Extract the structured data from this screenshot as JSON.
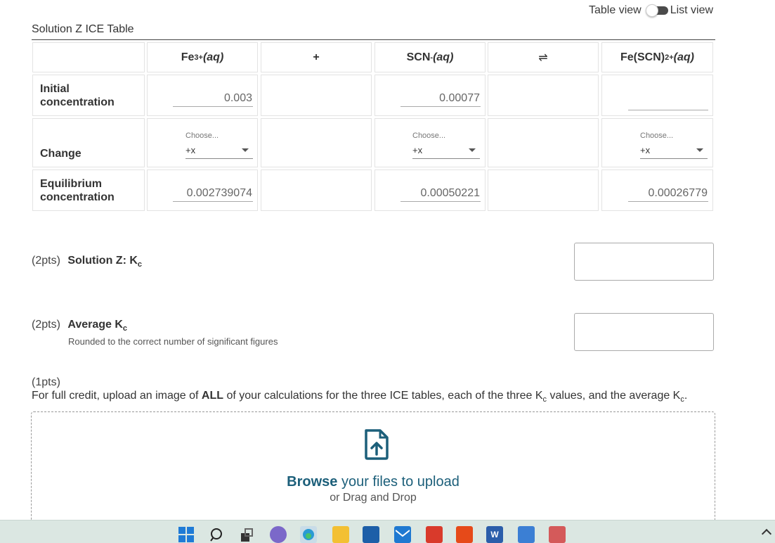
{
  "view_toggle": {
    "left_label": "Table view",
    "right_label": "List view"
  },
  "table": {
    "title": "Solution Z ICE Table",
    "headers": {
      "fe_base": "Fe",
      "fe_sup": "3+",
      "fe_aq": "(aq)",
      "plus": "+",
      "scn_base": "SCN",
      "scn_sup": "-",
      "scn_aq": "(aq)",
      "equilibrium": "⇌",
      "fescn_base": "Fe(SCN)",
      "fescn_sup": "2+",
      "fescn_aq": "(aq)"
    },
    "rows": {
      "initial_label": "Initial concentration",
      "change_label": "Change",
      "equilibrium_label": "Equilibrium concentration"
    },
    "initial": {
      "fe": "0.003",
      "scn": "0.00077",
      "fescn": ""
    },
    "change": {
      "placeholder": "Choose...",
      "fe": "+x",
      "scn": "+x",
      "fescn": "+x"
    },
    "equilibrium": {
      "fe": "0.002739074",
      "scn": "0.00050221",
      "fescn": "0.00026779"
    }
  },
  "questions": {
    "q1": {
      "points": "(2pts)",
      "title": "Solution Z: K",
      "title_sub": "c",
      "answer": ""
    },
    "q2": {
      "points": "(2pts)",
      "title": "Average K",
      "title_sub": "c",
      "subtitle": "Rounded to the correct number of significant figures",
      "answer": ""
    },
    "q3": {
      "points": "(1pts)",
      "text_a": "For full credit, upload an image of ",
      "text_bold": "ALL",
      "text_b": " of your calculations for the three ICE tables, each of the three K",
      "text_sub1": "c",
      "text_c": " values, and the average K",
      "text_sub2": "c",
      "text_d": "."
    }
  },
  "upload": {
    "browse": "Browse",
    "browse_rest": " your files to upload",
    "drag": "or Drag and Drop"
  },
  "taskbar": {
    "word_icon_letter": "W"
  },
  "colors": {
    "accent": "#1c5f7a",
    "taskbar": "#dbe7e2"
  }
}
